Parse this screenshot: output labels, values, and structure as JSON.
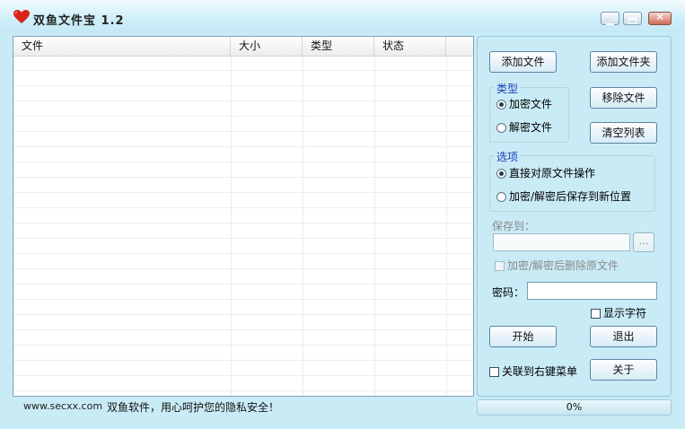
{
  "window": {
    "title": "双鱼文件宝  1.2",
    "icon": "heart-icon"
  },
  "file_table": {
    "columns": [
      "文件",
      "大小",
      "类型",
      "状态"
    ],
    "rows": []
  },
  "buttons": {
    "add_file": "添加文件",
    "add_folder": "添加文件夹",
    "remove_file": "移除文件",
    "clear_list": "清空列表",
    "browse": "...",
    "start": "开始",
    "exit": "退出",
    "about": "关于"
  },
  "type_group": {
    "label": "类型",
    "options": [
      "加密文件",
      "解密文件"
    ],
    "selected": "加密文件"
  },
  "options_group": {
    "label": "选项",
    "options": [
      "直接对原文件操作",
      "加密/解密后保存到新位置"
    ],
    "selected": "直接对原文件操作"
  },
  "save_to": {
    "label": "保存到：",
    "value": ""
  },
  "delete_original": {
    "label": "加密/解密后删除原文件",
    "checked": false
  },
  "password": {
    "label": "密码：",
    "value": ""
  },
  "show_chars": {
    "label": "显示字符",
    "checked": false
  },
  "context_menu": {
    "label": "关联到右键菜单",
    "checked": false
  },
  "status": {
    "site": "www.secxx.com",
    "message": "双鱼软件，用心呵护您的隐私安全！"
  },
  "progress": {
    "value": 0,
    "text": "0%"
  },
  "colors": {
    "accent": "#1a3fb8",
    "background": "#c9ebf6"
  }
}
